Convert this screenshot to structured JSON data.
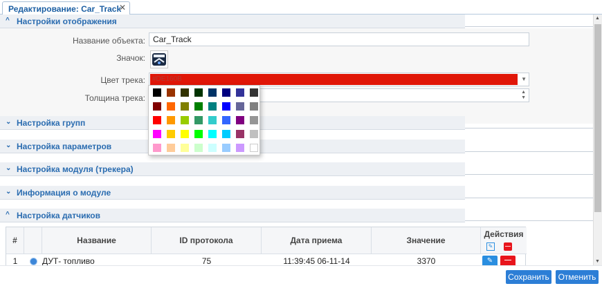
{
  "tab": {
    "title": "Редактирование: Car_Track",
    "close": "✕"
  },
  "sections": {
    "display": {
      "title": "Настройки отображения",
      "chevron": "^"
    },
    "groups": {
      "title": "Настройка групп",
      "chevron": "v"
    },
    "params": {
      "title": "Настройка параметров",
      "chevron": "v"
    },
    "module_tracker": {
      "title": "Настройка модуля (трекера)",
      "chevron": "v"
    },
    "module_info": {
      "title": "Информация о модуле",
      "chevron": "v"
    },
    "sensors": {
      "title": "Настройка датчиков",
      "chevron": "^"
    }
  },
  "form": {
    "name_label": "Название объекта:",
    "name_value": "Car_Track",
    "icon_label": "Значок:",
    "color_label": "Цвет трека:",
    "color_value": "#DE160B",
    "color_hex": "#e01608",
    "thickness_label": "Толщина трека:"
  },
  "palette": [
    [
      "#000000",
      "#993300",
      "#333300",
      "#003300",
      "#003366",
      "#000080",
      "#333399",
      "#333333"
    ],
    [
      "#800000",
      "#ff6600",
      "#808000",
      "#008000",
      "#008080",
      "#0000ff",
      "#666699",
      "#808080"
    ],
    [
      "#ff0000",
      "#ff9900",
      "#99cc00",
      "#339966",
      "#33cccc",
      "#3366ff",
      "#800080",
      "#969696"
    ],
    [
      "#ff00ff",
      "#ffcc00",
      "#ffff00",
      "#00ff00",
      "#00ffff",
      "#00ccff",
      "#993366",
      "#c0c0c0"
    ],
    [
      "#ff99cc",
      "#ffcc99",
      "#ffff99",
      "#ccffcc",
      "#ccffff",
      "#99ccff",
      "#cc99ff",
      "#ffffff"
    ]
  ],
  "table": {
    "headers": {
      "num": "#",
      "name": "Название",
      "protocol_id": "ID протокола",
      "received": "Дата приема",
      "value": "Значение",
      "actions": "Действия"
    },
    "rows": [
      {
        "num": "1",
        "name": "ДУТ- топливо",
        "protocol_id": "75",
        "received": "11:39:45 06-11-14",
        "value": "3370"
      }
    ]
  },
  "footer": {
    "save": "Сохранить",
    "cancel": "Отменить"
  }
}
